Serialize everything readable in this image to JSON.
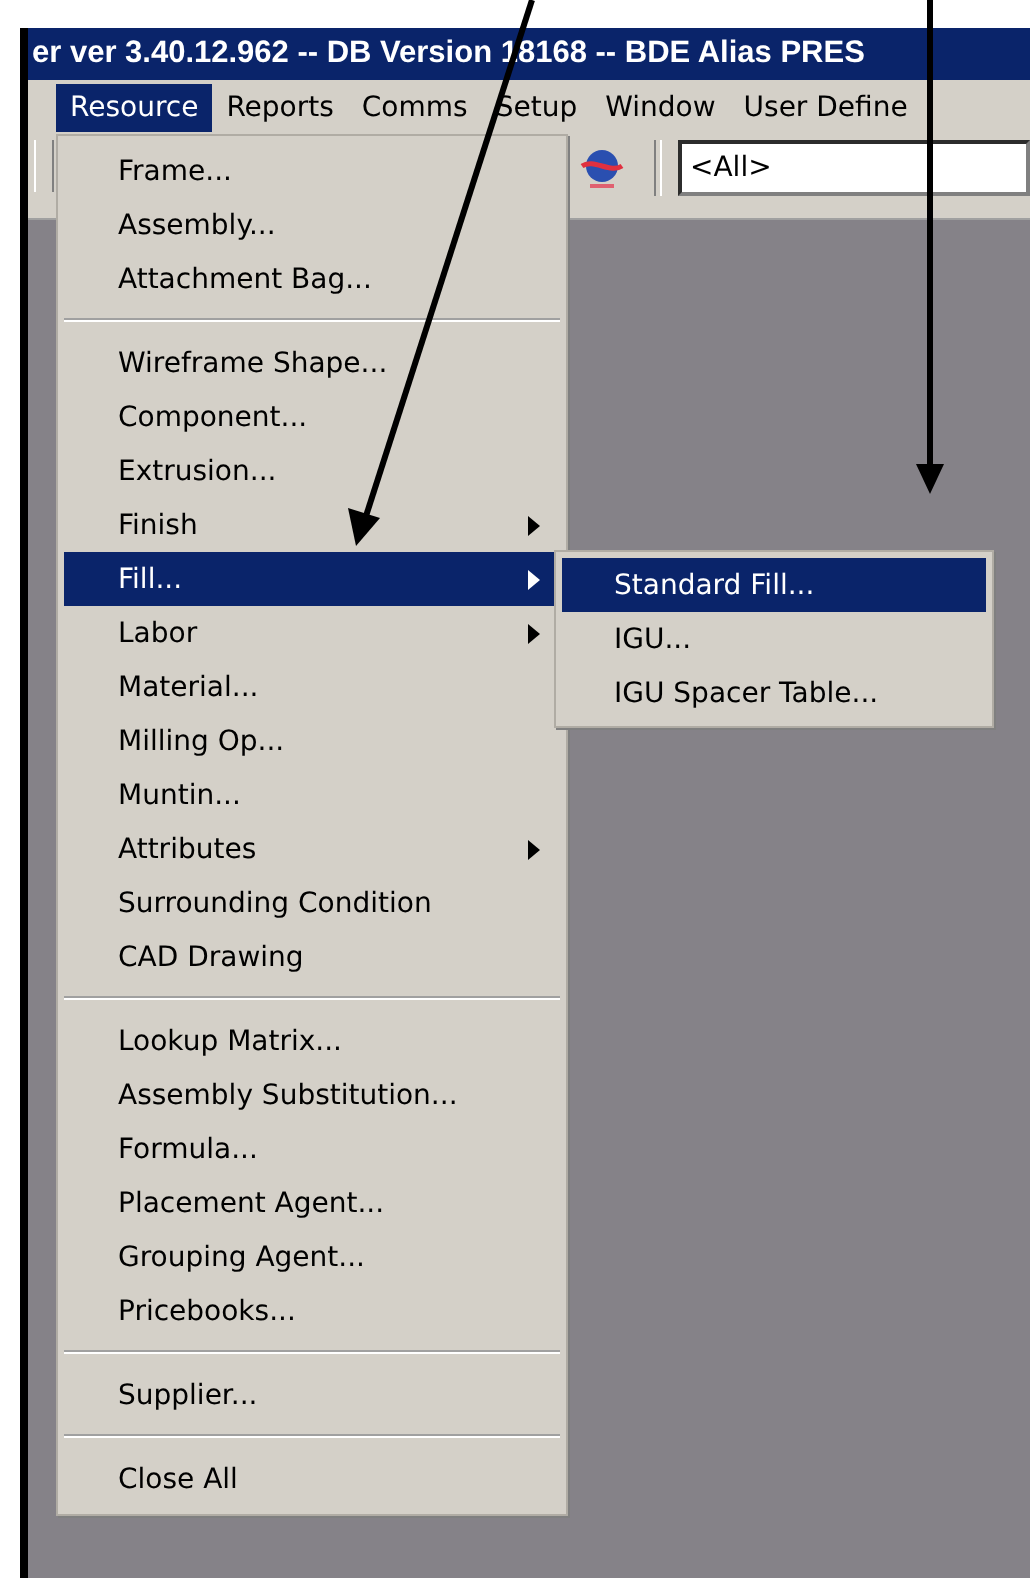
{
  "window": {
    "title": "er ver 3.40.12.962 -- DB Version 18168 -- BDE Alias PRES"
  },
  "menu_bar": [
    {
      "label": "Resource",
      "selected": true
    },
    {
      "label": "Reports",
      "selected": false
    },
    {
      "label": "Comms",
      "selected": false
    },
    {
      "label": "Setup",
      "selected": false
    },
    {
      "label": "Window",
      "selected": false
    },
    {
      "label": "User Define",
      "selected": false
    }
  ],
  "toolbar": {
    "filter": {
      "value": "<All>"
    }
  },
  "resource_menu": [
    {
      "kind": "item",
      "label": "Frame...",
      "submenu": false,
      "selected": false
    },
    {
      "kind": "item",
      "label": "Assembly...",
      "submenu": false,
      "selected": false
    },
    {
      "kind": "item",
      "label": "Attachment Bag...",
      "submenu": false,
      "selected": false
    },
    {
      "kind": "separator"
    },
    {
      "kind": "item",
      "label": "Wireframe Shape...",
      "submenu": false,
      "selected": false
    },
    {
      "kind": "item",
      "label": "Component...",
      "submenu": false,
      "selected": false
    },
    {
      "kind": "item",
      "label": "Extrusion...",
      "submenu": false,
      "selected": false
    },
    {
      "kind": "item",
      "label": "Finish",
      "submenu": true,
      "selected": false
    },
    {
      "kind": "item",
      "label": "Fill...",
      "submenu": true,
      "selected": true
    },
    {
      "kind": "item",
      "label": "Labor",
      "submenu": true,
      "selected": false
    },
    {
      "kind": "item",
      "label": "Material...",
      "submenu": false,
      "selected": false
    },
    {
      "kind": "item",
      "label": "Milling Op...",
      "submenu": false,
      "selected": false
    },
    {
      "kind": "item",
      "label": "Muntin...",
      "submenu": false,
      "selected": false
    },
    {
      "kind": "item",
      "label": "Attributes",
      "submenu": true,
      "selected": false
    },
    {
      "kind": "item",
      "label": "Surrounding Condition",
      "submenu": false,
      "selected": false
    },
    {
      "kind": "item",
      "label": "CAD Drawing",
      "submenu": false,
      "selected": false
    },
    {
      "kind": "separator"
    },
    {
      "kind": "item",
      "label": "Lookup Matrix...",
      "submenu": false,
      "selected": false
    },
    {
      "kind": "item",
      "label": "Assembly Substitution...",
      "submenu": false,
      "selected": false
    },
    {
      "kind": "item",
      "label": "Formula...",
      "submenu": false,
      "selected": false
    },
    {
      "kind": "item",
      "label": "Placement Agent...",
      "submenu": false,
      "selected": false
    },
    {
      "kind": "item",
      "label": "Grouping Agent...",
      "submenu": false,
      "selected": false
    },
    {
      "kind": "item",
      "label": "Pricebooks...",
      "submenu": false,
      "selected": false
    },
    {
      "kind": "separator"
    },
    {
      "kind": "item",
      "label": "Supplier...",
      "submenu": false,
      "selected": false
    },
    {
      "kind": "separator"
    },
    {
      "kind": "item",
      "label": "Close All",
      "submenu": false,
      "selected": false
    }
  ],
  "fill_submenu": [
    {
      "label": "Standard Fill...",
      "selected": true
    },
    {
      "label": "IGU...",
      "selected": false
    },
    {
      "label": "IGU Spacer Table...",
      "selected": false
    }
  ]
}
